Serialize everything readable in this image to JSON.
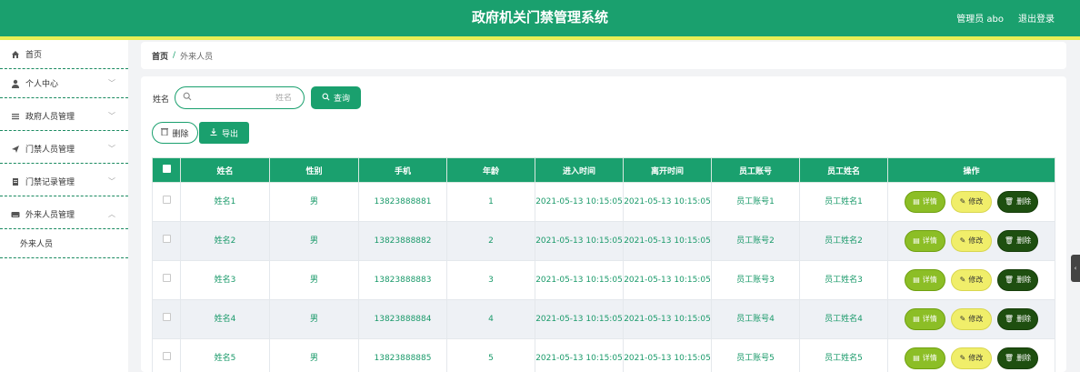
{
  "header": {
    "title": "政府机关门禁管理系统",
    "admin": "管理员 abo",
    "logout": "退出登录"
  },
  "sidebar": {
    "items": [
      {
        "label": "首页",
        "icon": "home-icon"
      },
      {
        "label": "个人中心",
        "icon": "user-icon"
      },
      {
        "label": "政府人员管理",
        "icon": "list-icon"
      },
      {
        "label": "门禁人员管理",
        "icon": "send-icon"
      },
      {
        "label": "门禁记录管理",
        "icon": "document-icon"
      },
      {
        "label": "外来人员管理",
        "icon": "keyboard-icon"
      }
    ],
    "submenu": "外来人员"
  },
  "breadcrumb": {
    "home": "首页",
    "sep": "/",
    "current": "外来人员"
  },
  "search": {
    "label": "姓名",
    "placeholder": "姓名",
    "query_btn": "查询"
  },
  "actions": {
    "delete": "删除",
    "export": "导出"
  },
  "table": {
    "columns": [
      "姓名",
      "性别",
      "手机",
      "年龄",
      "进入时间",
      "离开时间",
      "员工账号",
      "员工姓名",
      "操作"
    ],
    "rows": [
      {
        "name": "姓名1",
        "gender": "男",
        "phone": "13823888881",
        "age": "1",
        "enter": "2021-05-13 10:15:05",
        "leave": "2021-05-13 10:15:05",
        "account": "员工账号1",
        "staff": "员工姓名1"
      },
      {
        "name": "姓名2",
        "gender": "男",
        "phone": "13823888882",
        "age": "2",
        "enter": "2021-05-13 10:15:05",
        "leave": "2021-05-13 10:15:05",
        "account": "员工账号2",
        "staff": "员工姓名2"
      },
      {
        "name": "姓名3",
        "gender": "男",
        "phone": "13823888883",
        "age": "3",
        "enter": "2021-05-13 10:15:05",
        "leave": "2021-05-13 10:15:05",
        "account": "员工账号3",
        "staff": "员工姓名3"
      },
      {
        "name": "姓名4",
        "gender": "男",
        "phone": "13823888884",
        "age": "4",
        "enter": "2021-05-13 10:15:05",
        "leave": "2021-05-13 10:15:05",
        "account": "员工账号4",
        "staff": "员工姓名4"
      },
      {
        "name": "姓名5",
        "gender": "男",
        "phone": "13823888885",
        "age": "5",
        "enter": "2021-05-13 10:15:05",
        "leave": "2021-05-13 10:15:05",
        "account": "员工账号5",
        "staff": "员工姓名5"
      }
    ],
    "ops": {
      "detail": "详情",
      "edit": "修改",
      "delete": "删除"
    }
  },
  "colors": {
    "primary": "#1aa06e",
    "accent_yellow": "#e8ee55",
    "detail": "#8cbe26",
    "edit": "#f0ee6a",
    "delete": "#1e4f10"
  }
}
